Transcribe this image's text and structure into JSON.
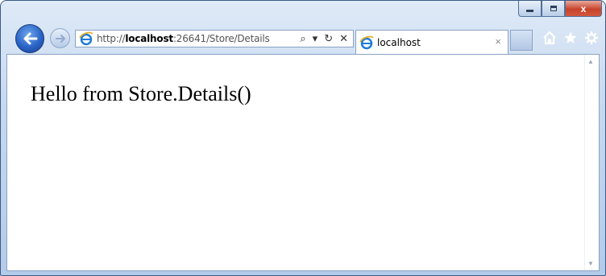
{
  "window": {
    "controls": {
      "minimize_icon": "minimize-icon",
      "maximize_icon": "maximize-icon",
      "close_icon": "close-icon",
      "close_glyph": "x"
    }
  },
  "nav": {
    "back_icon": "back-arrow-icon",
    "forward_icon": "forward-arrow-icon"
  },
  "address_bar": {
    "url_prefix": "http://",
    "url_host": "localhost",
    "url_rest": ":26641/Store/Details",
    "search_glyph": "⌕",
    "dropdown_glyph": "▾",
    "refresh_glyph": "↻",
    "stop_glyph": "✕"
  },
  "tab": {
    "title": "localhost",
    "close_glyph": "×"
  },
  "toolbar": {
    "icons": [
      "home-icon",
      "favorites-star-icon",
      "tools-gear-icon"
    ]
  },
  "page": {
    "heading": "Hello from Store.Details()"
  },
  "colors": {
    "frame": "#b3cbea",
    "accent": "#2a64c7",
    "close": "#c7432b"
  }
}
